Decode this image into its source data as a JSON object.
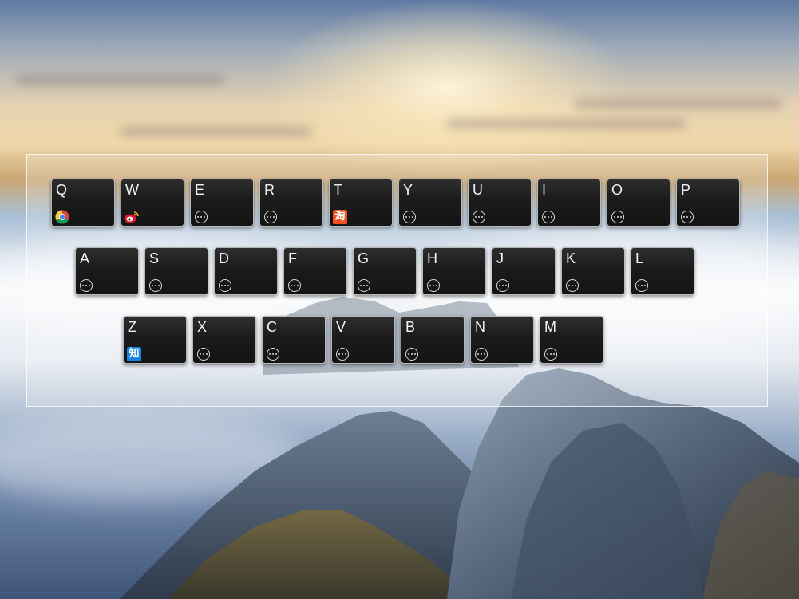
{
  "keyboard": {
    "rows": [
      {
        "keys": [
          {
            "letter": "Q",
            "icon": "chrome-icon"
          },
          {
            "letter": "W",
            "icon": "weibo-icon"
          },
          {
            "letter": "E",
            "icon": "more-icon"
          },
          {
            "letter": "R",
            "icon": "more-icon"
          },
          {
            "letter": "T",
            "icon": "taobao-icon"
          },
          {
            "letter": "Y",
            "icon": "more-icon"
          },
          {
            "letter": "U",
            "icon": "more-icon"
          },
          {
            "letter": "I",
            "icon": "more-icon"
          },
          {
            "letter": "O",
            "icon": "more-icon"
          },
          {
            "letter": "P",
            "icon": "more-icon"
          }
        ]
      },
      {
        "keys": [
          {
            "letter": "A",
            "icon": "more-icon"
          },
          {
            "letter": "S",
            "icon": "more-icon"
          },
          {
            "letter": "D",
            "icon": "more-icon"
          },
          {
            "letter": "F",
            "icon": "more-icon"
          },
          {
            "letter": "G",
            "icon": "more-icon"
          },
          {
            "letter": "H",
            "icon": "more-icon"
          },
          {
            "letter": "J",
            "icon": "more-icon"
          },
          {
            "letter": "K",
            "icon": "more-icon"
          },
          {
            "letter": "L",
            "icon": "more-icon"
          }
        ]
      },
      {
        "keys": [
          {
            "letter": "Z",
            "icon": "zhihu-icon"
          },
          {
            "letter": "X",
            "icon": "more-icon"
          },
          {
            "letter": "C",
            "icon": "more-icon"
          },
          {
            "letter": "V",
            "icon": "more-icon"
          },
          {
            "letter": "B",
            "icon": "more-icon"
          },
          {
            "letter": "N",
            "icon": "more-icon"
          },
          {
            "letter": "M",
            "icon": "more-icon"
          }
        ]
      }
    ],
    "icon_glyphs": {
      "taobao-icon": "淘",
      "zhihu-icon": "知"
    },
    "colors": {
      "taobao": "#f4511e",
      "zhihu": "#1683e8",
      "weibo": "#e6162d"
    }
  }
}
